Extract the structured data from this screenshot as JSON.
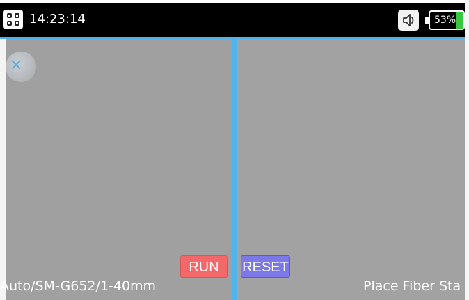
{
  "status_bar": {
    "time": "14:23:14",
    "battery_percent": 53,
    "battery_label": "53%",
    "menu_icon": "grid-menu-icon",
    "sound_icon": "speaker-icon"
  },
  "controls": {
    "run_label": "RUN",
    "reset_label": "RESET"
  },
  "footer": {
    "mode": "Auto/SM-G652/1-40mm",
    "status": "Place Fiber Sta"
  },
  "colors": {
    "accent": "#4fb5eb",
    "run": "#f3696a",
    "reset": "#7d78e8",
    "battery": "#37c93d"
  }
}
